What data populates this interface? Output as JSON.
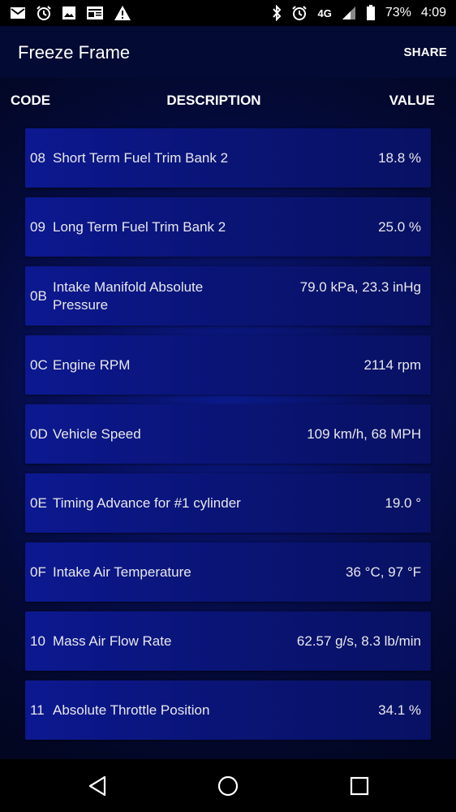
{
  "status_bar": {
    "icons_left": [
      "mail-icon",
      "alarm-icon",
      "image-icon",
      "news-icon",
      "warning-icon"
    ],
    "icons_right": [
      "bluetooth-icon",
      "alarm-icon",
      "network-icon",
      "signal-icon",
      "battery-icon"
    ],
    "network": "4G",
    "battery": "73%",
    "time": "4:09"
  },
  "appbar": {
    "title": "Freeze Frame",
    "share_label": "SHARE"
  },
  "header": {
    "code": "CODE",
    "description": "DESCRIPTION",
    "value": "VALUE"
  },
  "rows": [
    {
      "code": "08",
      "description": "Short Term Fuel Trim Bank 2",
      "value": "18.8 %"
    },
    {
      "code": "09",
      "description": "Long Term Fuel Trim Bank 2",
      "value": "25.0 %"
    },
    {
      "code": "0B",
      "description": "Intake Manifold Absolute Pressure",
      "value": "79.0 kPa, 23.3 inHg"
    },
    {
      "code": "0C",
      "description": "Engine RPM",
      "value": "2114 rpm"
    },
    {
      "code": "0D",
      "description": "Vehicle Speed",
      "value": "109 km/h, 68 MPH"
    },
    {
      "code": "0E",
      "description": "Timing Advance for #1 cylinder",
      "value": "19.0 °"
    },
    {
      "code": "0F",
      "description": "Intake Air Temperature",
      "value": "36 °C, 97 °F"
    },
    {
      "code": "10",
      "description": "Mass Air Flow Rate",
      "value": "62.57 g/s, 8.3 lb/min"
    },
    {
      "code": "11",
      "description": "Absolute Throttle Position",
      "value": "34.1 %"
    }
  ],
  "navbar": {
    "icons": [
      "back-icon",
      "home-icon",
      "recents-icon"
    ]
  }
}
